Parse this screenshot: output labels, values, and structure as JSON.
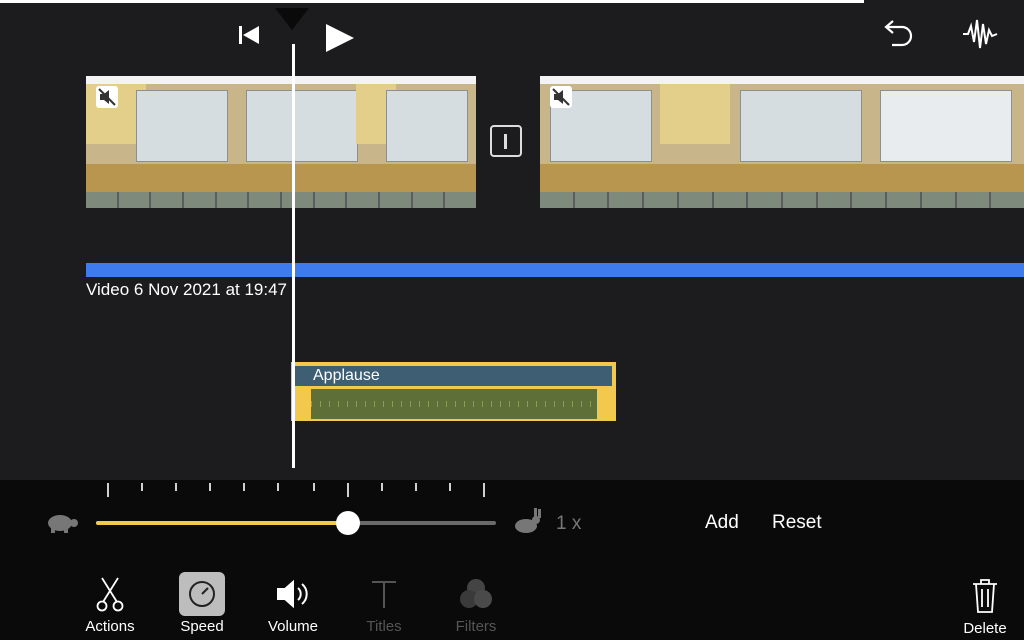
{
  "transport": {
    "skip_back_icon": "skip-to-start-icon",
    "play_icon": "play-icon",
    "undo_icon": "undo-icon",
    "audio_icon": "audio-waveform-icon"
  },
  "timeline": {
    "clip_title": "Video 6 Nov 2021 at 19:47",
    "audio_clip_label": "Applause",
    "accent_blue": "#3d7bef",
    "accent_yellow": "#f2c94c"
  },
  "speed": {
    "slow_icon": "tortoise-icon",
    "fast_icon": "hare-icon",
    "value_label": "1 x",
    "slider_fraction": 0.63,
    "add_label": "Add",
    "reset_label": "Reset"
  },
  "toolbar": {
    "tools": [
      {
        "label": "Actions",
        "icon": "scissors-icon"
      },
      {
        "label": "Speed",
        "icon": "speedometer-icon",
        "selected": true
      },
      {
        "label": "Volume",
        "icon": "speaker-icon"
      },
      {
        "label": "Titles",
        "icon": "text-t-icon",
        "disabled": true
      },
      {
        "label": "Filters",
        "icon": "filters-circles-icon",
        "disabled": true
      }
    ],
    "delete_label": "Delete",
    "delete_icon": "trash-icon"
  }
}
